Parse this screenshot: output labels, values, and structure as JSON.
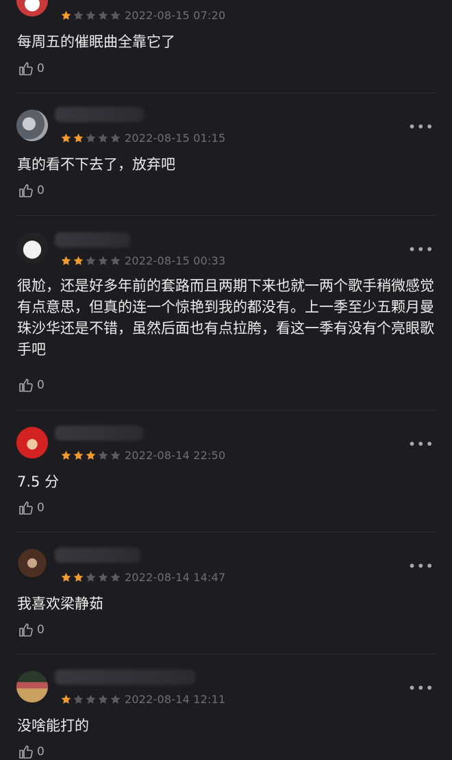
{
  "reviews": [
    {
      "rating": 1,
      "date": "2022-08-15 07:20",
      "content": "每周五的催眠曲全靠它了",
      "likes": "0",
      "avatar_color": "#c83a3a"
    },
    {
      "rating": 2,
      "date": "2022-08-15 01:15",
      "content": "真的看不下去了，放弃吧",
      "likes": "0",
      "avatar_color": "#8a8f96"
    },
    {
      "rating": 2,
      "date": "2022-08-15 00:33",
      "content": "很尬，还是好多年前的套路而且两期下来也就一两个歌手稍微感觉有点意思，但真的连一个惊艳到我的都没有。上一季至少五颗月曼珠沙华还是不错，虽然后面也有点拉胯，看这一季有没有个亮眼歌手吧",
      "likes": "0",
      "avatar_color": "#e6e6e6"
    },
    {
      "rating": 3,
      "date": "2022-08-14 22:50",
      "content": "7.5 分",
      "likes": "0",
      "avatar_color": "#d32222"
    },
    {
      "rating": 2,
      "date": "2022-08-14 14:47",
      "content": "我喜欢梁静茹",
      "likes": "0",
      "avatar_color": "#3a2a22"
    },
    {
      "rating": 1,
      "date": "2022-08-14 12:11",
      "content": "没啥能打的",
      "likes": "0",
      "avatar_color": "#7a4a40"
    }
  ],
  "more_label": "•••",
  "colors": {
    "star_on": "#f39a2b",
    "star_off": "#5a5a60",
    "background": "#1d1d21"
  }
}
